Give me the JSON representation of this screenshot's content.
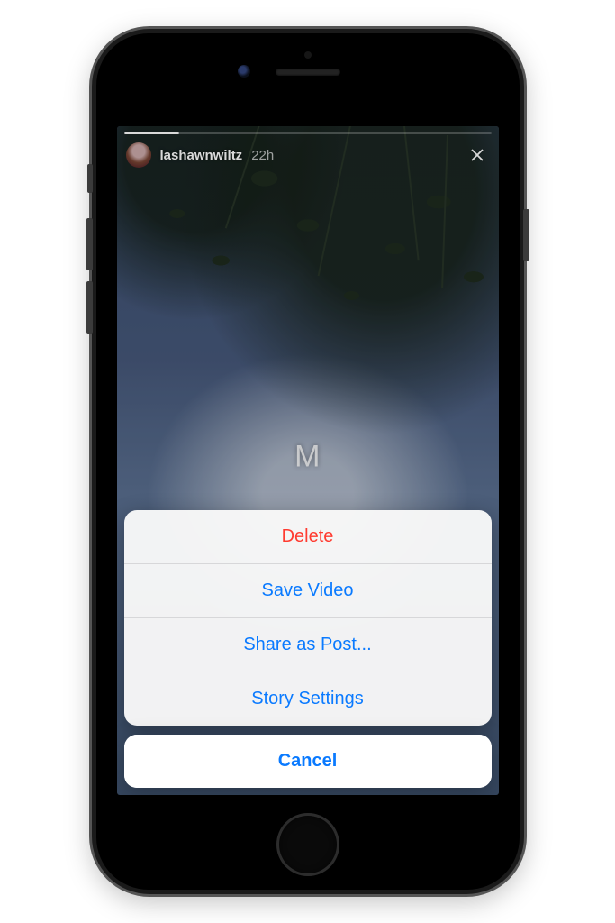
{
  "story": {
    "username": "lashawnwiltz",
    "timestamp": "22h",
    "caption": "M"
  },
  "actionsheet": {
    "options": [
      {
        "label": "Delete",
        "destructive": true
      },
      {
        "label": "Save Video",
        "destructive": false
      },
      {
        "label": "Share as Post...",
        "destructive": false
      },
      {
        "label": "Story Settings",
        "destructive": false
      }
    ],
    "cancel_label": "Cancel"
  }
}
